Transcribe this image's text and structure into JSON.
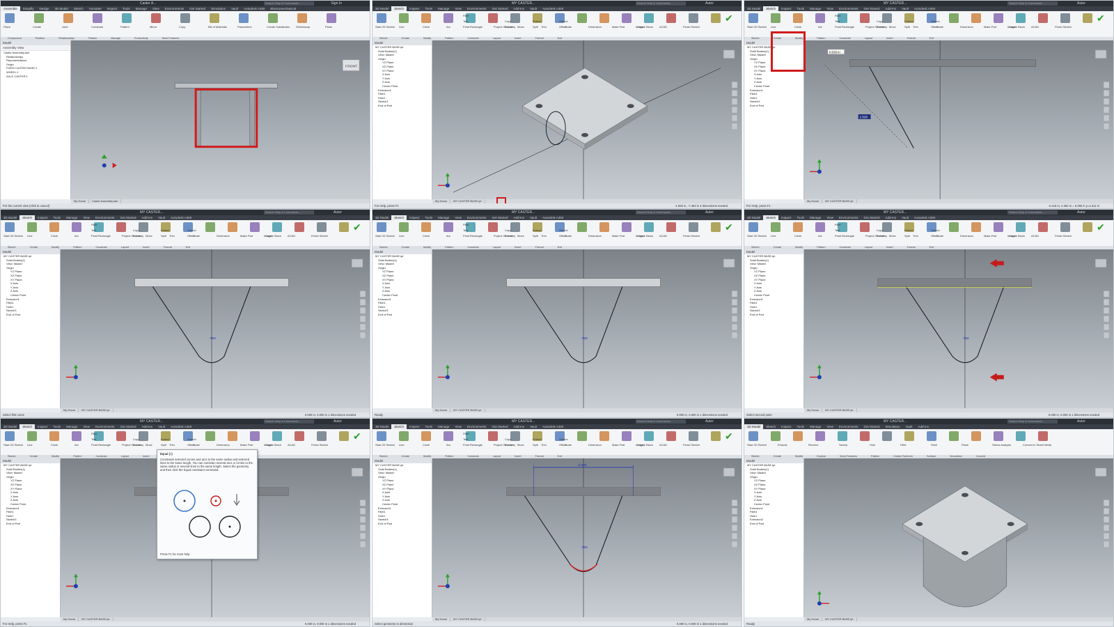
{
  "status_left": [
    "For the current view (click to cancel)",
    "For Help, press F1",
    "For Help, press F1",
    "Select first curve",
    "Ready",
    "Select second point",
    "For Help, press F1",
    "Select geometry to dimension",
    "Ready"
  ],
  "status_right": [
    "",
    "-1.920 in, -7.493 in   3 dimensions needed",
    "-2.215 in, 2.362 in = 6.365 in  y=2.311 in",
    "0.000 in, 0.000 in   1 dimensions needed",
    "0.000 in, 0.000 in   1 dimensions needed",
    "0.000 in, 0.000 in   1 dimensions needed",
    "0.000 in, 0.000 in   1 dimensions needed",
    "0.000 in, 0.000 in   1 dimensions needed",
    ""
  ],
  "doc_tab_home": "My Home",
  "doc_tab_assembly": "Caster Assembly.iam",
  "doc_tab_part": "MY CASTER BASE.ipt",
  "title_assembly": "Caster A...",
  "title_part": "MY CASTER...",
  "search_placeholder": "Search Help & Commands...",
  "sign_in": "Sign In",
  "user": "Autor",
  "view_cube_label": "FRONT",
  "sketch_tabs": [
    "3D Model",
    "Sketch",
    "Inspect",
    "Tools",
    "Manage",
    "View",
    "Environments",
    "Get Started",
    "Add-Ins",
    "Vault",
    "Autodesk A360"
  ],
  "assembly_tabs": [
    "Assemble",
    "Simplify",
    "Design",
    "3D Model",
    "Sketch",
    "Annotate",
    "Inspect",
    "Tools",
    "Manage",
    "View",
    "Environments",
    "Get Started",
    "Simulation",
    "Vault",
    "Autodesk A360",
    "Electromechanical"
  ],
  "model_tabs": [
    "3D Model",
    "Sketch",
    "Inspect",
    "Tools",
    "Manage",
    "View",
    "Environments",
    "Get Started",
    "Simulation",
    "Vault",
    "Add-Ins"
  ],
  "sketch_groups": [
    "Sketch",
    "Create",
    "Modify",
    "Pattern",
    "Constrain",
    "Layout",
    "Insert",
    "Format",
    "Exit"
  ],
  "assembly_groups": [
    "Component",
    "Position",
    "Relationships",
    "Pattern",
    "Manage",
    "Productivity",
    "Work Features"
  ],
  "model_groups": [
    "Sketch",
    "Create",
    "Modify",
    "Explore",
    "Work Features",
    "Pattern",
    "Create Freeform",
    "Surface",
    "Simulation",
    "Convert"
  ],
  "sketch_ribbon": {
    "start": "Start 2D Sketch",
    "line": "Line",
    "circle": "Circle",
    "arc": "Arc",
    "rect": "Rectangle",
    "fillet": "Fillet",
    "text": "Text",
    "point": "Point",
    "project": "Project Geometry",
    "move": "Move",
    "copy": "Copy",
    "rotate": "Rotate",
    "trim": "Trim",
    "extend": "Extend",
    "split": "Split",
    "scale": "Scale",
    "stretch": "Stretch",
    "offset": "Offset",
    "dim": "Dimension",
    "make_part": "Make Part",
    "create_block": "Create Block",
    "image": "Image",
    "acad": "ACAD",
    "finish": "Finish Sketch"
  },
  "assembly_ribbon": {
    "place": "Place",
    "create": "Create",
    "joint": "Joint",
    "constrain": "Constrain",
    "pattern": "Pattern",
    "mirror": "Mirror",
    "copy": "Copy",
    "bom": "Bill of Materials",
    "params": "Parameters",
    "create_sub": "Create Substitutes",
    "shrinkwrap": "Shrinkwrap",
    "plane": "Plane"
  },
  "model_ribbon": {
    "start": "Start 2D Sketch",
    "extrude": "Extrude",
    "revolve": "Revolve",
    "sweep": "Sweep",
    "hole": "Hole",
    "fillet": "Fillet",
    "shell": "Shell",
    "plane": "Plane",
    "stress": "Stress Analysis",
    "convert": "Convert to Sheet Metal"
  },
  "browser_title": "Model",
  "assembly_browser_header": "Assembly View",
  "assembly_tree": [
    "Caster Assembly.iam",
    "Relationships",
    "Representations",
    "Origin",
    "FIXED CASTER BASE:1",
    "WHEEL:1",
    "AXLE CASTER:1"
  ],
  "part_tree": [
    "MY CASTER BASE.ipt",
    "Solid Bodies(1)",
    "View: Master",
    "Origin",
    "YZ Plane",
    "XZ Plane",
    "XY Plane",
    "X Axis",
    "Y Axis",
    "Z Axis",
    "Center Point",
    "Extrusion1",
    "Fillet1",
    "Hole1",
    "Sketch3",
    "End of Part"
  ],
  "model_tree": [
    "MY CASTER BASE.ipt",
    "Solid Bodies(1)",
    "View: Master",
    "Origin",
    "YZ Plane",
    "XZ Plane",
    "XY Plane",
    "X Axis",
    "Y Axis",
    "Z Axis",
    "Center Point",
    "Extrusion1",
    "Fillet1",
    "Hole1",
    "Extrusion2",
    "End of Part"
  ],
  "dim_750": ".750",
  "dim_input": "3.000",
  "dim_tag": "1.529",
  "len_tag": "0.639 in",
  "tooltip": {
    "title": "Equal (=)",
    "desc": "Constrains selected curves and arcs to the same radius and selected lines to the same length. You can constrain several arcs or circles to the same radius or several lines to the same length. Select the geometry and then click the Equal constraint command.",
    "help": "Press F1 for more help"
  },
  "colors": {
    "highlight_red": "#d01b1b",
    "sketch_curve": "#1b1f2a",
    "dimension_blue": "#1a2db5",
    "arrow_red": "#c41c1c",
    "finish_green": "#2aa02a"
  }
}
